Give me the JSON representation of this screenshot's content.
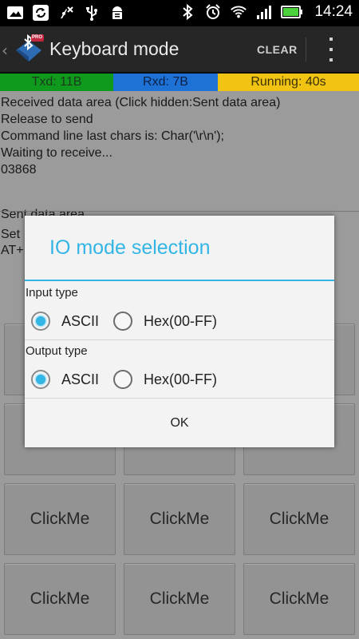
{
  "status_bar": {
    "time": "14:24",
    "left_icons": [
      "image-icon",
      "sync-icon",
      "no-signal-icon",
      "usb-icon",
      "android-debug-icon"
    ],
    "right_icons": [
      "bluetooth-icon",
      "alarm-icon",
      "wifi-icon",
      "cell-signal-icon",
      "battery-icon"
    ]
  },
  "action_bar": {
    "title": "Keyboard mode",
    "clear_label": "CLEAR",
    "logo_badge": "PRO"
  },
  "counters": {
    "txd": "Txd: 11B",
    "rxd": "Rxd: 7B",
    "running": "Running: 40s"
  },
  "colors": {
    "txd": "#0f9a1d",
    "rxd": "#1e72d6",
    "running": "#f1c413",
    "accent": "#33b5e5"
  },
  "receive_area": {
    "header": "Received data area   (Click hidden:Sent data area)",
    "lines": [
      "Release to send",
      "Command line last chars is: Char('\\r\\n');",
      "Waiting to receive...",
      "03868"
    ]
  },
  "sent_area": {
    "header": "Sent data area",
    "line1": "Set",
    "line2": "AT+"
  },
  "grid_buttons": [
    "",
    "",
    "",
    "",
    "",
    "",
    "ClickMe",
    "ClickMe",
    "ClickMe",
    "ClickMe",
    "ClickMe",
    "ClickMe"
  ],
  "dialog": {
    "title": "IO mode selection",
    "input_type_label": "Input type",
    "output_type_label": "Output type",
    "input_options": [
      {
        "label": "ASCII",
        "checked": true
      },
      {
        "label": "Hex(00-FF)",
        "checked": false
      }
    ],
    "output_options": [
      {
        "label": "ASCII",
        "checked": true
      },
      {
        "label": "Hex(00-FF)",
        "checked": false
      }
    ],
    "ok_label": "OK"
  }
}
